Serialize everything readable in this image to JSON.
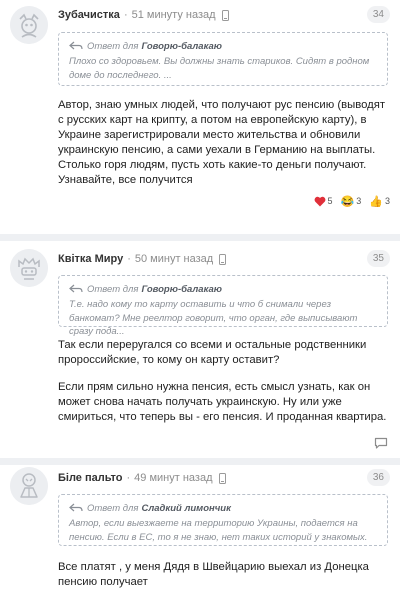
{
  "comments": [
    {
      "author": "Зубачистка",
      "time": "51 минуту назад",
      "number": "34",
      "quote_prefix": "Ответ для",
      "quote_to": "Говорю-балакаю",
      "quote_text": "Плохо со здоровьем. Вы должны знать стариков. Сидят в родном доме до последнего. ...",
      "body": [
        "Автор, знаю умных людей, что получают рус пенсию (выводят с русских карт на крипту, а потом на европейскую карту), в Украине зарегистрировали место жительства и обновили украинскую пенсию, а сами уехали в Германию на выплаты. Столько горя людям, пусть хоть какие-то деньги получают. Узнавайте, все получится"
      ],
      "reactions": [
        {
          "icon": "heart-icon",
          "count": "5"
        },
        {
          "icon": "laughing-face-icon",
          "glyph": "😂",
          "count": "3"
        },
        {
          "icon": "thumbs-up-icon",
          "glyph": "👍",
          "count": "3"
        }
      ]
    },
    {
      "author": "Квітка Миру",
      "time": "50 минут назад",
      "number": "35",
      "quote_prefix": "Ответ для",
      "quote_to": "Говорю-балакаю",
      "quote_text": "Т.е. надо кому то карту оставить и что б снимали через банкомат? Мне реелтор говорит, что орган, где выписывают сразу пода...",
      "body": [
        "Так если переругался со всеми и остальные родственники пророссийские, то кому он карту оставит?",
        "Если прям сильно нужна пенсия, есть смысл узнать, как он может снова начать получать украинскую. Ну или уже смириться, что теперь вы - его пенсия. И проданная квартира."
      ]
    },
    {
      "author": "Біле пальто",
      "time": "49 минут назад",
      "number": "36",
      "quote_prefix": "Ответ для",
      "quote_to": "Сладкий лимончик",
      "quote_text": "Автор, если выезжаете на территорию Украины, подается на пенсию. Если в ЕС, то я не знаю, нет таких историй у знакомых.",
      "body": [
        "Все платят , у меня Дядя в Швейцарию выехал из Донецка пенсию получает"
      ]
    }
  ],
  "colors": {
    "separator": "#eef0f3",
    "quote_border": "#b9c0ca",
    "heart": "#e0303a"
  }
}
